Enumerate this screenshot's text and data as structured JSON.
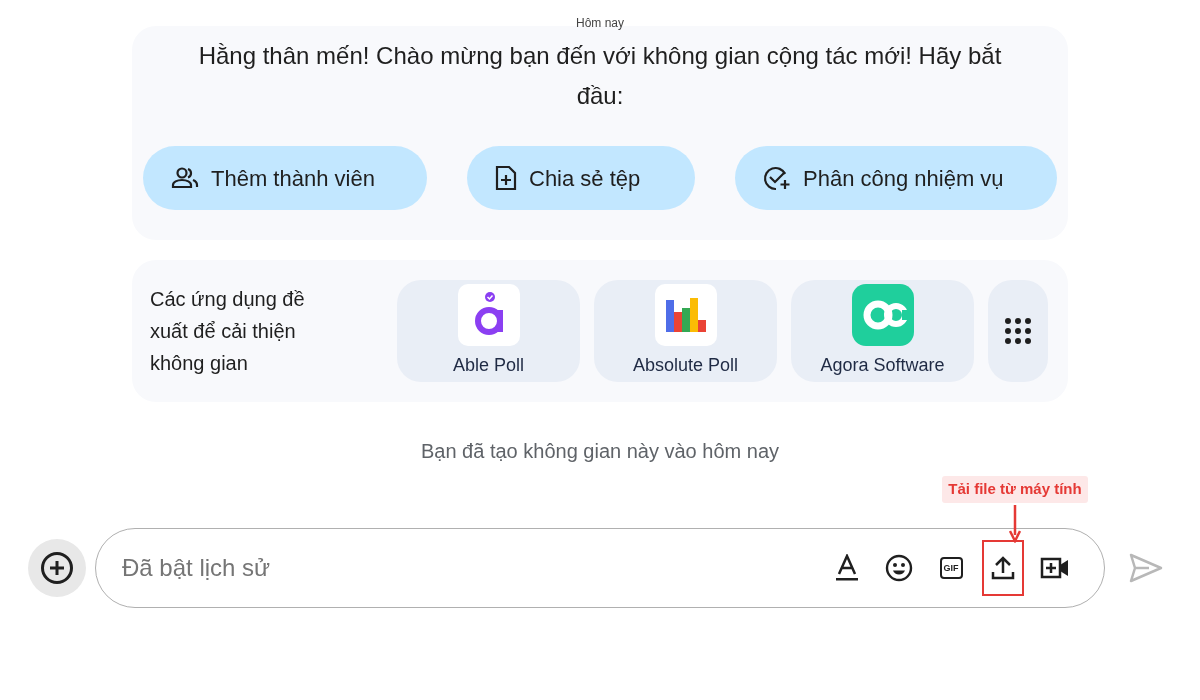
{
  "date_divider": "Hôm nay",
  "welcome": {
    "message": "Hằng thân mến! Chào mừng bạn đến với không gian cộng tác mới! Hãy bắt đầu:",
    "actions": [
      {
        "kind": "members",
        "label": "Thêm thành viên"
      },
      {
        "kind": "file",
        "label": "Chia sẻ tệp"
      },
      {
        "kind": "task",
        "label": "Phân công nhiệm vụ"
      }
    ]
  },
  "suggested_apps": {
    "label": "Các ứng dụng đề xuất để cải thiện không gian",
    "apps": [
      {
        "kind": "able",
        "name": "Able Poll"
      },
      {
        "kind": "absolute",
        "name": "Absolute Poll"
      },
      {
        "kind": "agora",
        "name": "Agora Software"
      }
    ]
  },
  "created_note": "Bạn đã tạo không gian này vào hôm nay",
  "composer": {
    "placeholder": "Đã bật lịch sử",
    "tools": [
      {
        "kind": "format"
      },
      {
        "kind": "emoji"
      },
      {
        "kind": "gif",
        "label": "GIF"
      },
      {
        "kind": "upload",
        "highlighted": true
      },
      {
        "kind": "video"
      }
    ]
  },
  "annotation": "Tải file từ máy tính"
}
